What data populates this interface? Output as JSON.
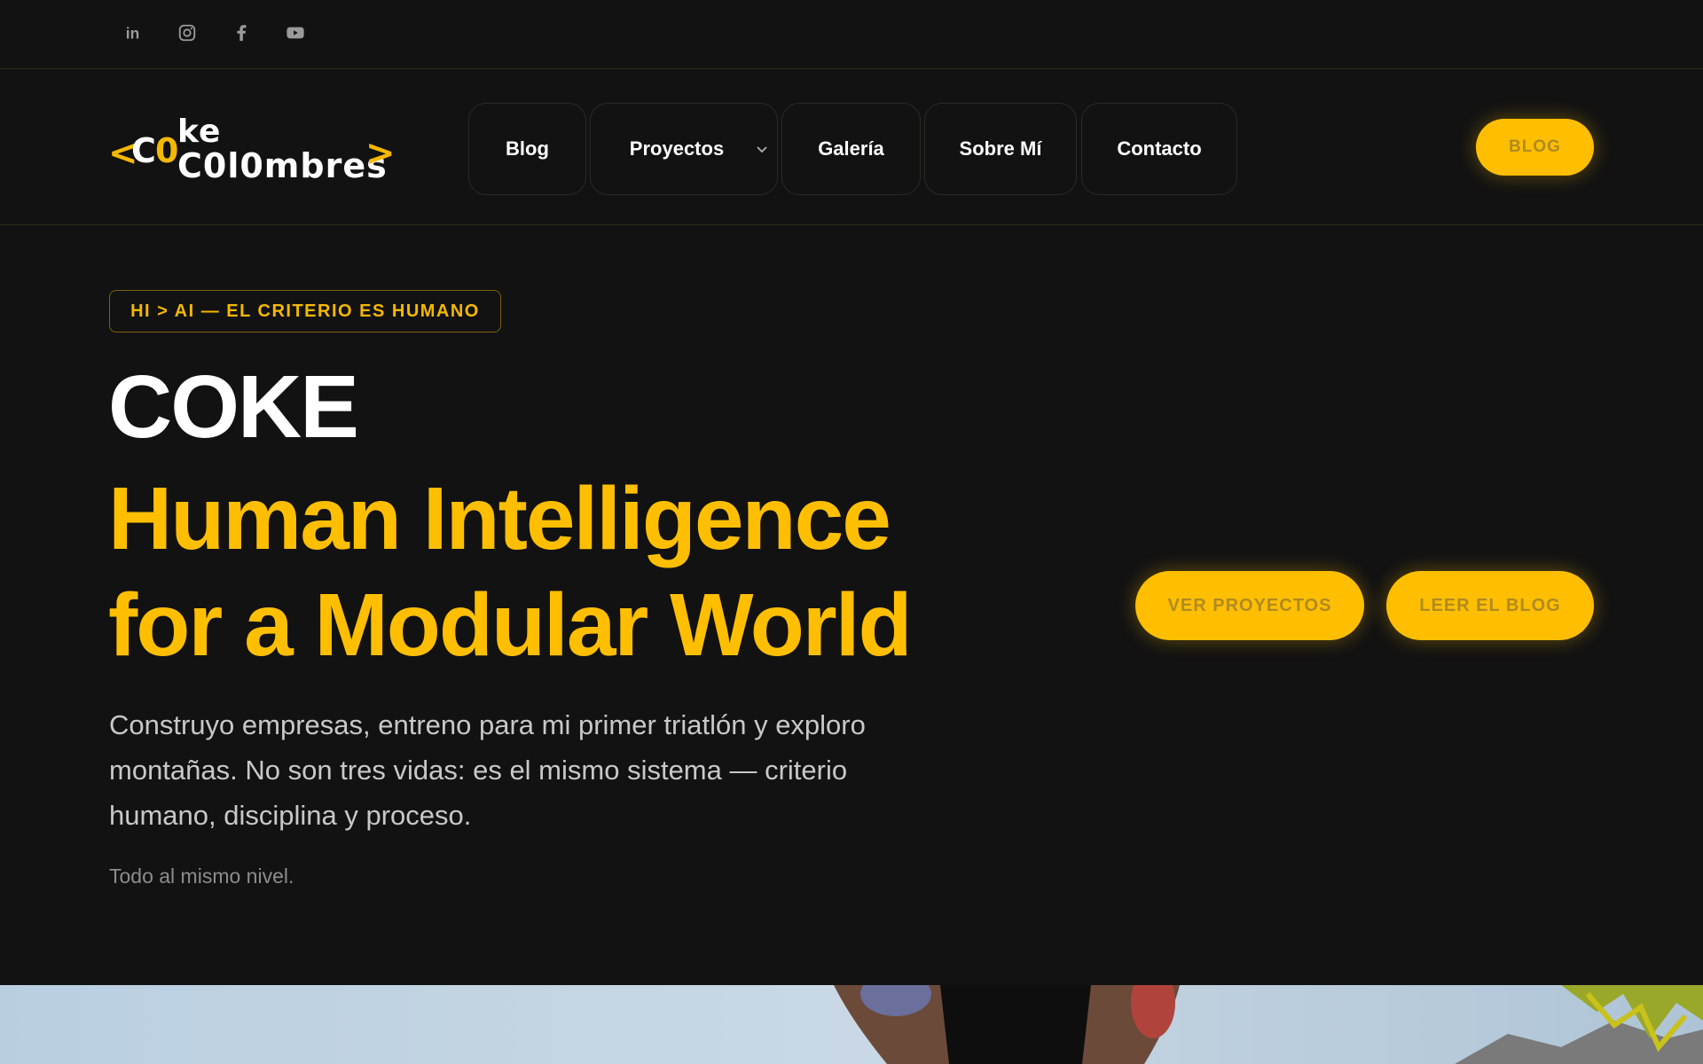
{
  "social": [
    {
      "name": "linkedin-icon",
      "glyph": "in"
    },
    {
      "name": "instagram-icon"
    },
    {
      "name": "facebook-icon",
      "glyph": "f"
    },
    {
      "name": "youtube-icon"
    }
  ],
  "logo": {
    "bracket_open": "<",
    "c": "C",
    "o": "0",
    "top": "ke",
    "bottom": "C0l0mbres",
    "bracket_close": ">"
  },
  "nav": {
    "items": [
      {
        "label": "Blog"
      },
      {
        "label": "Proyectos",
        "has_dropdown": true
      },
      {
        "label": "Galería"
      },
      {
        "label": "Sobre Mí"
      },
      {
        "label": "Contacto"
      }
    ],
    "cta": "BLOG"
  },
  "hero": {
    "tag": "HI > AI — EL CRITERIO ES HUMANO",
    "title": "COKE",
    "subtitle_line1": "Human Intelligence",
    "subtitle_line2": "for a Modular World",
    "lead": "Construyo empresas, entreno para mi primer triatlón y exploro montañas. No son tres vidas: es el mismo sistema — criterio humano, disciplina y proceso.",
    "small": "Todo al mismo nivel.",
    "buttons": [
      "VER PROYECTOS",
      "LEER EL BLOG"
    ]
  },
  "colors": {
    "background": "#121212",
    "accent": "#ffbf00",
    "text": "#ffffff",
    "muted": "#c8c8c8"
  }
}
